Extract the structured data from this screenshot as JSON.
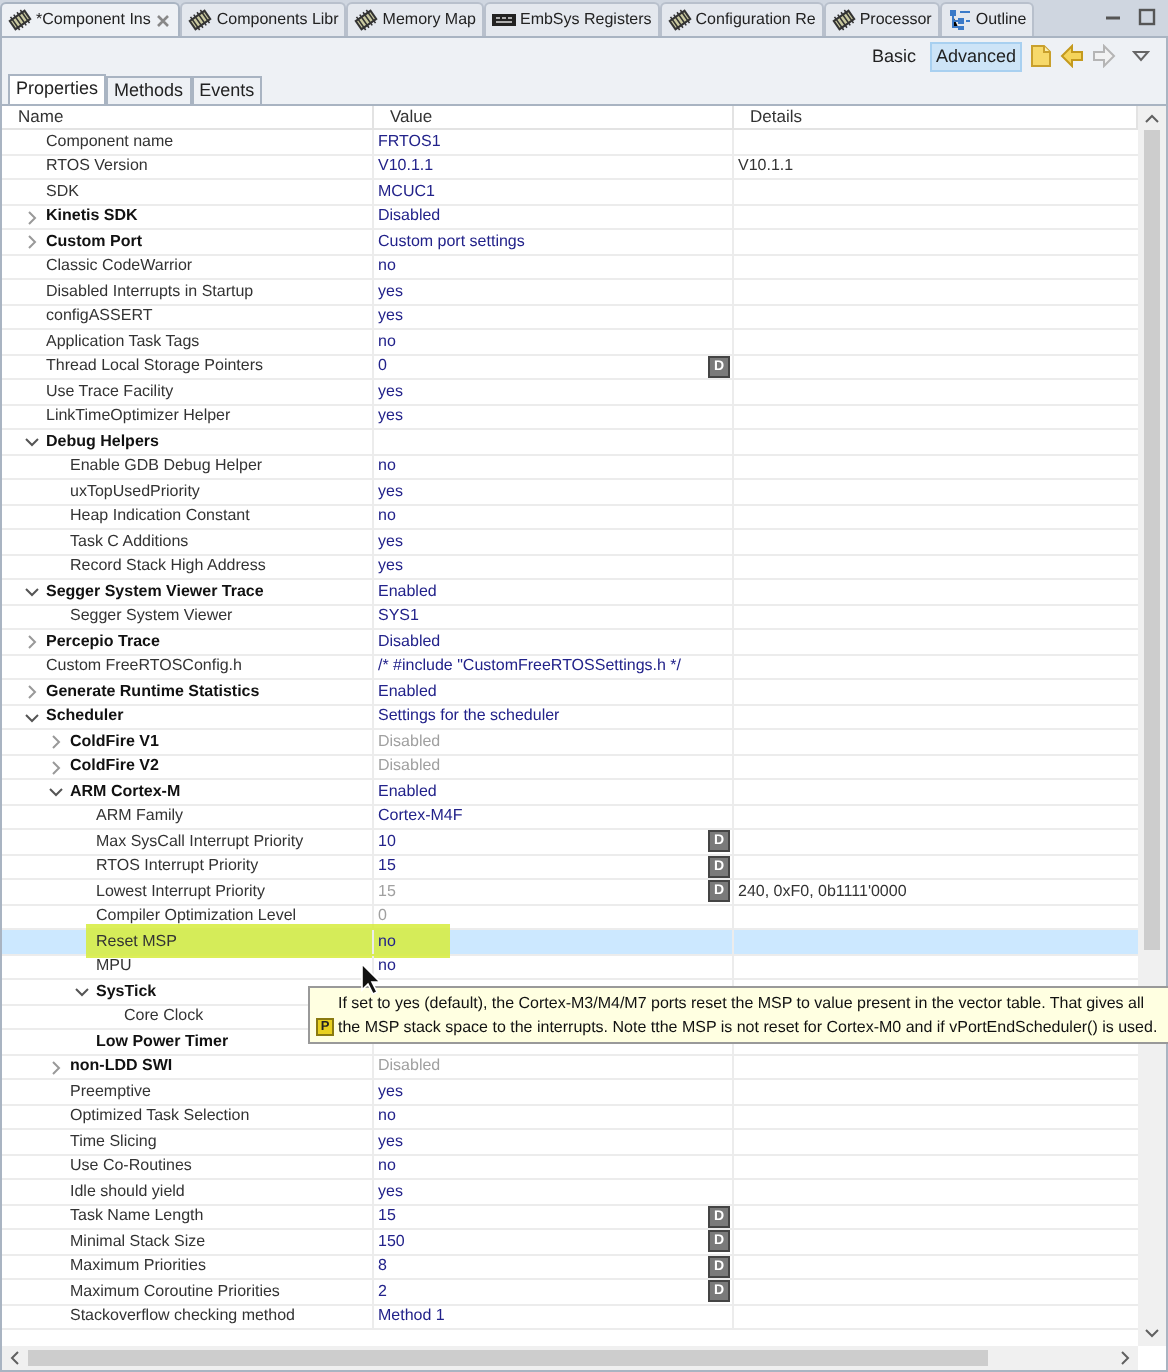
{
  "tabs": [
    {
      "label": "*Component Ins",
      "selected": true
    },
    {
      "label": "Components Libr",
      "selected": false
    },
    {
      "label": "Memory Map",
      "selected": false
    },
    {
      "label": "EmbSys Registers",
      "selected": false
    },
    {
      "label": "Configuration Re",
      "selected": false
    },
    {
      "label": "Processor",
      "selected": false
    },
    {
      "label": "Outline",
      "selected": false
    }
  ],
  "mode_buttons": [
    {
      "label": "Basic",
      "selected": false
    },
    {
      "label": "Advanced",
      "selected": true
    }
  ],
  "subtabs": [
    {
      "label": "Properties",
      "selected": true
    },
    {
      "label": "Methods",
      "selected": false
    },
    {
      "label": "Events",
      "selected": false
    }
  ],
  "columns": [
    "Name",
    "Value",
    "Details"
  ],
  "rows": [
    {
      "name": "Component name",
      "value": "FRTOS1"
    },
    {
      "name": "RTOS Version",
      "value": "V10.1.1",
      "details": "V10.1.1"
    },
    {
      "name": "SDK",
      "value": "MCUC1"
    },
    {
      "name": "Kinetis SDK",
      "value": "Disabled",
      "expanded": false
    },
    {
      "name": "Custom Port",
      "value": "Custom port settings",
      "expanded": false
    },
    {
      "name": "Classic CodeWarrior",
      "value": "no"
    },
    {
      "name": "Disabled Interrupts in Startup",
      "value": "yes"
    },
    {
      "name": "configASSERT",
      "value": "yes"
    },
    {
      "name": "Application Task Tags",
      "value": "no"
    },
    {
      "name": "Thread Local Storage Pointers",
      "value": "0",
      "button": "D"
    },
    {
      "name": "Use Trace Facility",
      "value": "yes"
    },
    {
      "name": "LinkTimeOptimizer Helper",
      "value": "yes"
    },
    {
      "name": "Debug Helpers",
      "expanded": true,
      "children": [
        {
          "name": "Enable GDB Debug Helper",
          "value": "no"
        },
        {
          "name": "uxTopUsedPriority",
          "value": "yes"
        },
        {
          "name": "Heap Indication Constant",
          "value": "no"
        },
        {
          "name": "Task C Additions",
          "value": "yes"
        },
        {
          "name": "Record Stack High Address",
          "value": "yes"
        }
      ]
    },
    {
      "name": "Segger System Viewer Trace",
      "value": "Enabled",
      "expanded": true,
      "children": [
        {
          "name": "Segger System Viewer",
          "value": "SYS1"
        }
      ]
    },
    {
      "name": "Percepio Trace",
      "value": "Disabled",
      "expanded": false
    },
    {
      "name": "Custom FreeRTOSConfig.h",
      "value": "/* #include \"CustomFreeRTOSSettings.h */"
    },
    {
      "name": "Generate Runtime Statistics",
      "value": "Enabled",
      "expanded": false
    },
    {
      "name": "Scheduler",
      "value": "Settings for the scheduler",
      "expanded": true,
      "children": [
        {
          "name": "ColdFire V1",
          "value": "Disabled",
          "disabled": true,
          "expanded": false
        },
        {
          "name": "ColdFire V2",
          "value": "Disabled",
          "disabled": true,
          "expanded": false
        },
        {
          "name": "ARM Cortex-M",
          "value": "Enabled",
          "expanded": true,
          "children": [
            {
              "name": "ARM Family",
              "value": "Cortex-M4F"
            },
            {
              "name": "Max SysCall Interrupt Priority",
              "value": "10",
              "button": "D"
            },
            {
              "name": "RTOS Interrupt Priority",
              "value": "15",
              "button": "D"
            },
            {
              "name": "Lowest Interrupt Priority",
              "value": "15",
              "button": "D",
              "details": "240, 0xF0, 0b1111'0000",
              "disabled": true
            },
            {
              "name": "Compiler Optimization Level",
              "value": "0",
              "disabled": true
            },
            {
              "name": "Reset MSP",
              "value": "no",
              "selected": true,
              "highlighted": true
            },
            {
              "name": "MPU",
              "value": "no"
            },
            {
              "name": "SysTick",
              "expanded": true,
              "children": [
                {
                  "name": "Core Clock"
                }
              ]
            },
            {
              "name": "Low Power Timer",
              "kind": "group"
            }
          ]
        },
        {
          "name": "non-LDD SWI",
          "value": "Disabled",
          "disabled": true,
          "expanded": false
        },
        {
          "name": "Preemptive",
          "value": "yes"
        },
        {
          "name": "Optimized Task Selection",
          "value": "no"
        },
        {
          "name": "Time Slicing",
          "value": "yes"
        },
        {
          "name": "Use Co-Routines",
          "value": "no"
        },
        {
          "name": "Idle should yield",
          "value": "yes"
        },
        {
          "name": "Task Name Length",
          "value": "15",
          "button": "D"
        },
        {
          "name": "Minimal Stack Size",
          "value": "150",
          "button": "D"
        },
        {
          "name": "Maximum Priorities",
          "value": "8",
          "button": "D"
        },
        {
          "name": "Maximum Coroutine Priorities",
          "value": "2",
          "button": "D"
        },
        {
          "name": "Stackoverflow checking method",
          "value": "Method 1"
        }
      ]
    }
  ],
  "tooltip": {
    "icon": "P",
    "lines": [
      "If set to yes (default), the Cortex-M3/M4/M7 ports reset the MSP to value present in the vector table. That gives all",
      "the MSP stack space to the interrupts. Note tthe MSP is not reset for Cortex-M0 and if vPortEndScheduler() is used."
    ]
  }
}
